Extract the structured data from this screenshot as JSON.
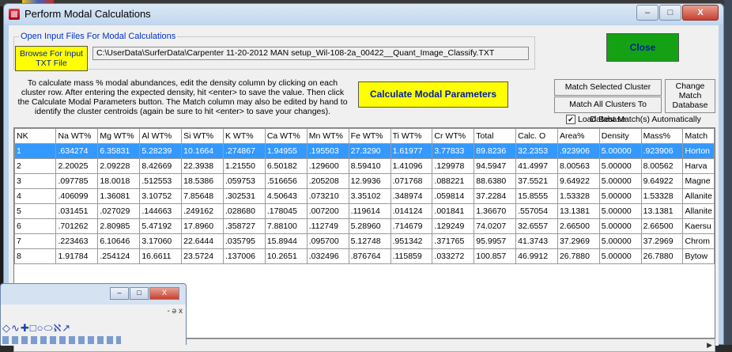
{
  "background": {
    "ghost_text": "... ... ... ... ..."
  },
  "window": {
    "title": "Perform Modal Calculations",
    "minimize": "–",
    "maximize": "□",
    "close": "X"
  },
  "input_group": {
    "legend": "Open Input Files For Modal Calculations",
    "browse_label": "Browse For Input TXT File",
    "path": "C:\\UserData\\SurferData\\Carpenter 11-20-2012 MAN setup_Wil-108-2a_00422__Quant_Image_Classify.TXT"
  },
  "instructions": "To calculate mass % modal abundances, edit the density column by clicking on each cluster row. After entering the expected density, hit <enter> to save the value. Then click the Calculate Modal Parameters button. The Match column may also be edited by hand to identify the cluster centroids (again be sure to hit <enter> to save your changes).",
  "buttons": {
    "calculate": "Calculate Modal Parameters",
    "close": "Close",
    "match_selected": "Match Selected Cluster",
    "match_all": "Match All Clusters To Database",
    "change_db": "Change Match Database"
  },
  "load_best": {
    "label": "Load Best Match(s) Automatically",
    "checked": "✔"
  },
  "colors": {
    "yellow": "#ffff00",
    "green": "#14a214",
    "selection": "#3399ff"
  },
  "table": {
    "headers": [
      "NK",
      "Na WT%",
      "Mg WT%",
      "Al WT%",
      "Si WT%",
      "K WT%",
      "Ca WT%",
      "Mn WT%",
      "Fe WT%",
      "Ti WT%",
      "Cr WT%",
      "Total",
      "Calc. O",
      "Area%",
      "Density",
      "Mass%",
      "Match"
    ],
    "rows": [
      [
        "1",
        ".634274",
        "6.35831",
        "5.28239",
        "10.1664",
        ".274867",
        "1.94955",
        ".195503",
        "27.3290",
        "1.61977",
        "3.77833",
        "89.8236",
        "32.2353",
        ".923906",
        "5.00000",
        ".923906",
        "Horton"
      ],
      [
        "2",
        "2.20025",
        "2.09228",
        "8.42669",
        "22.3938",
        "1.21550",
        "6.50182",
        ".129600",
        "8.59410",
        "1.41096",
        ".129978",
        "94.5947",
        "41.4997",
        "8.00563",
        "5.00000",
        "8.00562",
        "Harva"
      ],
      [
        "3",
        ".097785",
        "18.0018",
        ".512553",
        "18.5386",
        ".059753",
        ".516656",
        ".205208",
        "12.9936",
        ".071768",
        ".088221",
        "88.6380",
        "37.5521",
        "9.64922",
        "5.00000",
        "9.64922",
        "Magne"
      ],
      [
        "4",
        ".406099",
        "1.36081",
        "3.10752",
        "7.85648",
        ".302531",
        "4.50643",
        ".073210",
        "3.35102",
        ".348974",
        ".059814",
        "37.2284",
        "15.8555",
        "1.53328",
        "5.00000",
        "1.53328",
        "Allanite"
      ],
      [
        "5",
        ".031451",
        ".027029",
        ".144663",
        ".249162",
        ".028680",
        ".178045",
        ".007200",
        ".119614",
        ".014124",
        ".001841",
        "1.36670",
        ".557054",
        "13.1381",
        "5.00000",
        "13.1381",
        "Allanite"
      ],
      [
        "6",
        ".701262",
        "2.80985",
        "5.47192",
        "17.8960",
        ".358727",
        "7.88100",
        ".112749",
        "5.28960",
        ".714679",
        ".129249",
        "74.0207",
        "32.6557",
        "2.66500",
        "5.00000",
        "2.66500",
        "Kaersu"
      ],
      [
        "7",
        ".223463",
        "6.10646",
        "3.17060",
        "22.6444",
        ".035795",
        "15.8944",
        ".095700",
        "5.12748",
        ".951342",
        ".371765",
        "95.9957",
        "41.3743",
        "37.2969",
        "5.00000",
        "37.2969",
        "Chrom"
      ],
      [
        "8",
        "1.91784",
        ".254124",
        "16.6611",
        "23.5724",
        ".137006",
        "10.2651",
        ".032496",
        ".876764",
        ".115859",
        ".033272",
        "100.857",
        "46.9912",
        "26.7880",
        "5.00000",
        "26.7880",
        "Bytow"
      ]
    ]
  },
  "mini_window": {
    "minimize": "–",
    "maximize": "□",
    "close": "X",
    "controls": "- ə x",
    "tools": "◇∿✚□○⬭ℵ↗"
  }
}
